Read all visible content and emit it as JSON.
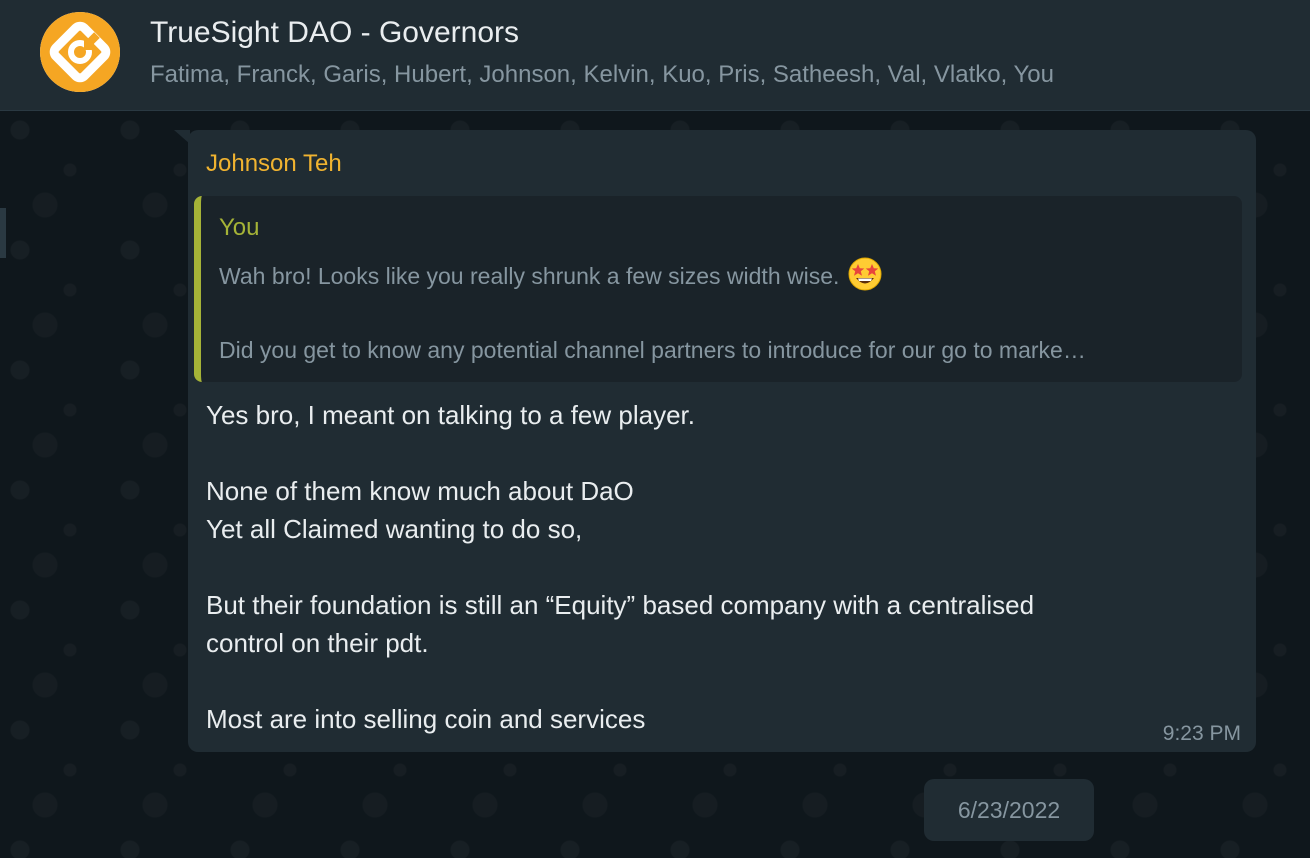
{
  "header": {
    "title": "TrueSight DAO - Governors",
    "members": "Fatima, Franck, Garis, Hubert, Johnson, Kelvin, Kuo, Pris, Satheesh, Val, Vlatko, You",
    "avatar_icon": "truesight-logo-icon",
    "avatar_color": "#f5a623"
  },
  "message": {
    "sender": "Johnson Teh",
    "sender_color": "#f0b330",
    "quote": {
      "author": "You",
      "author_color": "#a5b337",
      "line1": "Wah bro! Looks like you really shrunk a few sizes width wise.",
      "emoji": "star-struck-emoji-icon",
      "line2": "Did you get to know any potential channel partners to introduce for our go to marke…"
    },
    "lines": [
      "Yes bro, I meant on talking to a few player.",
      "None of them know much about DaO",
      "Yet all Claimed wanting to do so,",
      "But their foundation is still an “Equity” based company with a centralised",
      "control on their pdt.",
      "Most are into selling coin and services"
    ],
    "time": "9:23 PM"
  },
  "date_chip": "6/23/2022"
}
